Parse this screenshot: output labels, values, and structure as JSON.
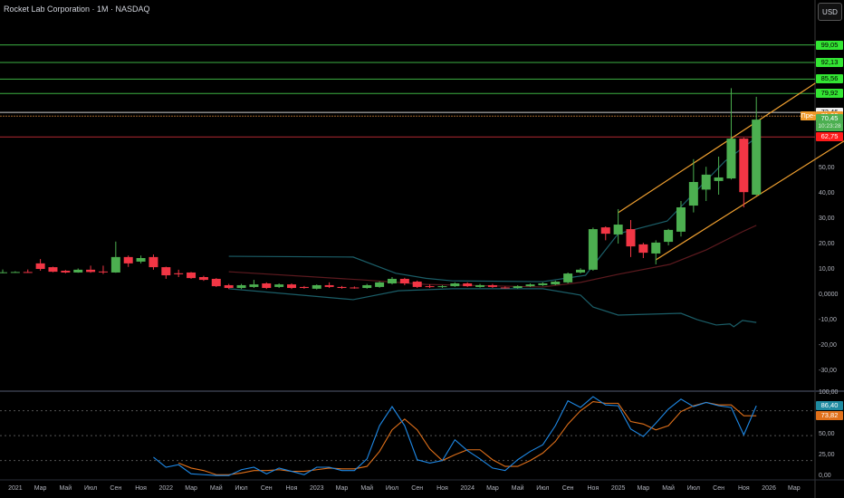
{
  "header": {
    "title": "Rocket Lab Corporation · 1M · NASDAQ",
    "currency_button": "USD"
  },
  "colors": {
    "up": "#4caf50",
    "down": "#f23645",
    "band": "#1b5e68",
    "basis": "#5d1a1f",
    "channel": "#f0a030",
    "level_green": "#3cb043",
    "osc_k": "#1e88e5",
    "osc_d": "#e0701a"
  },
  "chart_data": {
    "type": "candlestick",
    "title": "Rocket Lab Corporation · 1M · NASDAQ",
    "ylim": [
      -42,
      117
    ],
    "price_ticks": [
      "50,00",
      "40,00",
      "30,00",
      "20,00",
      "10,00",
      "0,0000",
      "-10,00",
      "-20,00",
      "-30,00"
    ],
    "price_tick_values": [
      50,
      40,
      30,
      20,
      10,
      0,
      -10,
      -20,
      -30
    ],
    "x_labels": [
      "2021",
      "Мар",
      "Май",
      "Июл",
      "Сен",
      "Ноя",
      "2022",
      "Мар",
      "Май",
      "Июл",
      "Сен",
      "Ноя",
      "2023",
      "Мар",
      "Май",
      "Июл",
      "Сен",
      "Ноя",
      "2024",
      "Мар",
      "Май",
      "Июл",
      "Сен",
      "Ноя",
      "2025",
      "Мар",
      "Май",
      "Июл",
      "Сен",
      "Ноя",
      "2026",
      "Мар"
    ],
    "candles_ohlc": [
      [
        9.3,
        10.5,
        9.0,
        9.4
      ],
      [
        9.4,
        9.8,
        9.2,
        9.5
      ],
      [
        9.5,
        10.5,
        9.2,
        9.3
      ],
      [
        12.9,
        14.6,
        10,
        10.7
      ],
      [
        11.4,
        11.6,
        9.4,
        9.6
      ],
      [
        10,
        10.3,
        9,
        9.3
      ],
      [
        9.3,
        10.9,
        9.2,
        10.4
      ],
      [
        10.4,
        12,
        9.2,
        9.5
      ],
      [
        9.7,
        12,
        8.7,
        9.5
      ],
      [
        9.3,
        21.5,
        9.2,
        15.4
      ],
      [
        15.4,
        16,
        11.5,
        12.9
      ],
      [
        13.6,
        16,
        12.9,
        15
      ],
      [
        15.4,
        16.4,
        10.4,
        11.4
      ],
      [
        11.4,
        11.6,
        6.8,
        8.2
      ],
      [
        9,
        10.4,
        7.5,
        8.6
      ],
      [
        9.3,
        9.5,
        6.8,
        7.1
      ],
      [
        7.5,
        8,
        6,
        6.4
      ],
      [
        6.8,
        7.1,
        3.6,
        3.9
      ],
      [
        4.3,
        4.8,
        2.8,
        3.2
      ],
      [
        3.2,
        4.8,
        2.8,
        4.3
      ],
      [
        3.6,
        6.4,
        3.2,
        4.6
      ],
      [
        5,
        5.4,
        2.8,
        3.2
      ],
      [
        3.6,
        5,
        3.2,
        4.6
      ],
      [
        4.6,
        5,
        2.8,
        3.2
      ],
      [
        3.6,
        4,
        2.9,
        3.2
      ],
      [
        2.9,
        4.6,
        2.6,
        4.3
      ],
      [
        4.3,
        5.4,
        3.2,
        3.6
      ],
      [
        3.6,
        4,
        2.9,
        3.2
      ],
      [
        3.4,
        3.8,
        2.9,
        3.2
      ],
      [
        3.2,
        4.8,
        2.9,
        4.3
      ],
      [
        3.6,
        5.8,
        3.3,
        5.4
      ],
      [
        5,
        7.5,
        4.6,
        6.8
      ],
      [
        6.8,
        7.2,
        4.3,
        5
      ],
      [
        5.7,
        6.1,
        3.2,
        3.6
      ],
      [
        3.9,
        4.6,
        3.2,
        3.6
      ],
      [
        3.6,
        4.3,
        3.2,
        3.9
      ],
      [
        3.9,
        5.4,
        3.6,
        5.0
      ],
      [
        5,
        5.4,
        3.6,
        3.9
      ],
      [
        3.6,
        4.8,
        3.3,
        4.3
      ],
      [
        4.3,
        4.8,
        3.2,
        3.6
      ],
      [
        3.4,
        3.8,
        2.9,
        3.2
      ],
      [
        3.2,
        4.3,
        2.9,
        3.9
      ],
      [
        3.9,
        5.0,
        3.6,
        4.6
      ],
      [
        4.3,
        5.4,
        4,
        5.0
      ],
      [
        4.6,
        6.1,
        4.3,
        5.7
      ],
      [
        5.4,
        9.3,
        5,
        8.9
      ],
      [
        9.3,
        11,
        8.9,
        10.4
      ],
      [
        10.4,
        27,
        10,
        26.4
      ],
      [
        27.1,
        27.5,
        22,
        24.6
      ],
      [
        24.3,
        34.3,
        20.7,
        28.2
      ],
      [
        26.4,
        30,
        15.4,
        19.6
      ],
      [
        20.4,
        21,
        15,
        17.1
      ],
      [
        16.8,
        22,
        12.5,
        21.1
      ],
      [
        21.4,
        26.5,
        20,
        26.1
      ],
      [
        25.4,
        37.5,
        23.5,
        35
      ],
      [
        35.7,
        54,
        33,
        45
      ],
      [
        42,
        51,
        37.5,
        47.9
      ],
      [
        45.4,
        55,
        40,
        46.8
      ],
      [
        46.4,
        82,
        46,
        62.1
      ],
      [
        62.1,
        62.5,
        35,
        41
      ],
      [
        40,
        78.6,
        39.6,
        69.6
      ]
    ],
    "bands": {
      "upper": [
        [
          18,
          15.7
        ],
        [
          27.9,
          15.4
        ],
        [
          31.3,
          9
        ],
        [
          33.7,
          7
        ],
        [
          35.8,
          6
        ],
        [
          43,
          5.7
        ],
        [
          46.4,
          8.2
        ],
        [
          49,
          24.6
        ],
        [
          52.9,
          29.6
        ],
        [
          57.5,
          53.2
        ],
        [
          60,
          62.5
        ]
      ],
      "basis": [
        [
          18,
          9.6
        ],
        [
          28.6,
          6.4
        ],
        [
          33.7,
          4.6
        ],
        [
          43,
          3.6
        ],
        [
          46,
          5.4
        ],
        [
          49,
          8.6
        ],
        [
          53.1,
          12.5
        ],
        [
          56,
          18.2
        ],
        [
          58.9,
          25.4
        ],
        [
          60,
          27.9
        ]
      ],
      "lower": [
        [
          18,
          2.9
        ],
        [
          27.9,
          -1.4
        ],
        [
          31.5,
          2.1
        ],
        [
          35.8,
          2.9
        ],
        [
          43,
          2.9
        ],
        [
          46,
          0.4
        ],
        [
          47,
          -4.3
        ],
        [
          49,
          -7.5
        ],
        [
          54,
          -6.8
        ],
        [
          55.3,
          -9.3
        ],
        [
          56.8,
          -11.4
        ],
        [
          57.9,
          -11
        ],
        [
          58.2,
          -12.1
        ],
        [
          58.9,
          -9.6
        ],
        [
          60,
          -10.4
        ]
      ]
    },
    "channel": {
      "upper": [
        [
          49,
          32.9
        ],
        [
          64.7,
          84
        ]
      ],
      "lower": [
        [
          52,
          14.3
        ],
        [
          67,
          61.2
        ]
      ]
    },
    "levels": [
      {
        "price": 99.05,
        "label": "99,05",
        "kind": "green"
      },
      {
        "price": 92.13,
        "label": "92,13",
        "kind": "green"
      },
      {
        "price": 85.56,
        "label": "85,56",
        "kind": "green"
      },
      {
        "price": 79.92,
        "label": "79,92",
        "kind": "green"
      },
      {
        "price": 72.46,
        "label": "72,46",
        "kind": "white"
      },
      {
        "price": 71.0,
        "label": "71,00",
        "kind": "orange"
      },
      {
        "price": 62.75,
        "label": "62,75",
        "kind": "red"
      }
    ],
    "premarket_label": "Пре-",
    "last_price": {
      "value": 70.45,
      "label": "70,45",
      "countdown": "10:23:28"
    },
    "oscillator": {
      "ticks": [
        "100,00",
        "50,00",
        "25,00",
        "0,00"
      ],
      "tick_values": [
        100,
        50,
        25,
        0
      ],
      "dotted_levels": [
        80,
        50,
        20
      ],
      "k_start": 12,
      "k": [
        24,
        12,
        15,
        4,
        3,
        2,
        2,
        9,
        12,
        4,
        11,
        7,
        3,
        12,
        12,
        8,
        8,
        22,
        62,
        85,
        62,
        21,
        17,
        20,
        45,
        32,
        22,
        11,
        8,
        21,
        31,
        39,
        62,
        92,
        84,
        97,
        87,
        86,
        58,
        49,
        65,
        82,
        94,
        85,
        90,
        86,
        84,
        51,
        86
      ],
      "d_start": 14,
      "d": [
        17,
        11,
        8,
        3,
        3,
        5,
        8,
        8,
        9,
        7,
        7,
        9,
        11,
        10,
        10,
        13,
        31,
        57,
        70,
        57,
        34,
        20,
        27,
        33,
        33,
        21,
        13,
        13,
        20,
        29,
        43,
        64,
        80,
        91,
        89,
        89,
        67,
        64,
        57,
        62,
        79,
        86,
        90,
        87,
        87,
        74,
        74
      ],
      "k_label": "86,40",
      "d_label": "73,82"
    }
  }
}
